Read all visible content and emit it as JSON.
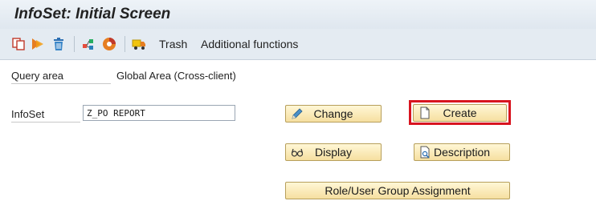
{
  "window": {
    "title": "InfoSet: Initial Screen"
  },
  "toolbar": {
    "icons": [
      "copy-icon",
      "execute-icon",
      "delete-icon",
      "tree-icon",
      "pie-chart-icon",
      "truck-icon"
    ],
    "trash_label": "Trash",
    "additional_functions_label": "Additional functions"
  },
  "form": {
    "query_area_label": "Query area",
    "query_area_value": "Global Area (Cross-client)",
    "infoset_label": "InfoSet",
    "infoset_value": "Z_PO REPORT"
  },
  "buttons": {
    "change": {
      "label": "Change",
      "icon": "pencil-icon"
    },
    "create": {
      "label": "Create",
      "icon": "document-icon"
    },
    "display": {
      "label": "Display",
      "icon": "glasses-icon"
    },
    "description": {
      "label": "Description",
      "icon": "document-search-icon"
    },
    "role_assignment": {
      "label": "Role/User Group Assignment"
    }
  },
  "colors": {
    "highlight": "#d8141f",
    "button_fill": "#f6dfa0"
  }
}
